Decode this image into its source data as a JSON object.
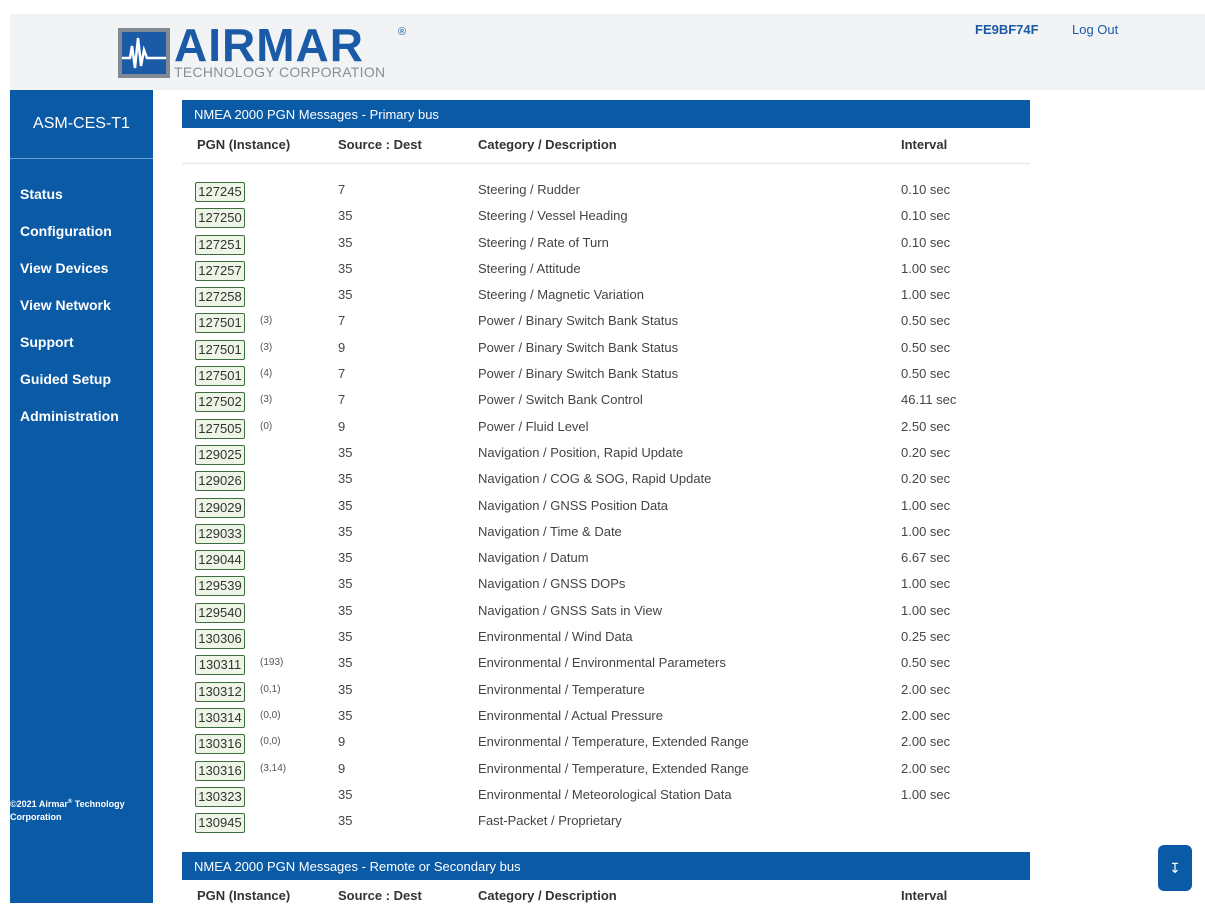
{
  "header": {
    "logo_word": "AIRMAR",
    "logo_reg": "®",
    "logo_sub": "TECHNOLOGY CORPORATION",
    "device_id": "FE9BF74F",
    "logout_label": "Log Out"
  },
  "sidebar": {
    "unit_name": "ASM-CES-T1",
    "items": [
      {
        "label": "Status"
      },
      {
        "label": "Configuration"
      },
      {
        "label": "View Devices"
      },
      {
        "label": "View Network"
      },
      {
        "label": "Support"
      },
      {
        "label": "Guided Setup"
      },
      {
        "label": "Administration"
      }
    ],
    "copyright_line1": "©2021 Airmar",
    "copyright_reg": "®",
    "copyright_line1_rest": " Technology",
    "copyright_line2": "Corporation"
  },
  "primary": {
    "title": "NMEA 2000 PGN Messages - Primary bus",
    "columns": {
      "pgn": "PGN (Instance)",
      "src": "Source : Dest",
      "desc": "Category / Description",
      "interval": "Interval"
    },
    "rows": [
      {
        "pgn": "127245",
        "inst": "",
        "src": "7",
        "desc": "Steering / Rudder",
        "interval": "0.10 sec"
      },
      {
        "pgn": "127250",
        "inst": "",
        "src": "35",
        "desc": "Steering / Vessel Heading",
        "interval": "0.10 sec"
      },
      {
        "pgn": "127251",
        "inst": "",
        "src": "35",
        "desc": "Steering / Rate of Turn",
        "interval": "0.10 sec"
      },
      {
        "pgn": "127257",
        "inst": "",
        "src": "35",
        "desc": "Steering / Attitude",
        "interval": "1.00 sec"
      },
      {
        "pgn": "127258",
        "inst": "",
        "src": "35",
        "desc": "Steering / Magnetic Variation",
        "interval": "1.00 sec"
      },
      {
        "pgn": "127501",
        "inst": "(3)",
        "src": "7",
        "desc": "Power / Binary Switch Bank Status",
        "interval": "0.50 sec"
      },
      {
        "pgn": "127501",
        "inst": "(3)",
        "src": "9",
        "desc": "Power / Binary Switch Bank Status",
        "interval": "0.50 sec"
      },
      {
        "pgn": "127501",
        "inst": "(4)",
        "src": "7",
        "desc": "Power / Binary Switch Bank Status",
        "interval": "0.50 sec"
      },
      {
        "pgn": "127502",
        "inst": "(3)",
        "src": "7",
        "desc": "Power / Switch Bank Control",
        "interval": "46.11 sec"
      },
      {
        "pgn": "127505",
        "inst": "(0)",
        "src": "9",
        "desc": "Power / Fluid Level",
        "interval": "2.50 sec"
      },
      {
        "pgn": "129025",
        "inst": "",
        "src": "35",
        "desc": "Navigation / Position, Rapid Update",
        "interval": "0.20 sec"
      },
      {
        "pgn": "129026",
        "inst": "",
        "src": "35",
        "desc": "Navigation / COG & SOG, Rapid Update",
        "interval": "0.20 sec"
      },
      {
        "pgn": "129029",
        "inst": "",
        "src": "35",
        "desc": "Navigation / GNSS Position Data",
        "interval": "1.00 sec"
      },
      {
        "pgn": "129033",
        "inst": "",
        "src": "35",
        "desc": "Navigation / Time & Date",
        "interval": "1.00 sec"
      },
      {
        "pgn": "129044",
        "inst": "",
        "src": "35",
        "desc": "Navigation / Datum",
        "interval": "6.67 sec"
      },
      {
        "pgn": "129539",
        "inst": "",
        "src": "35",
        "desc": "Navigation / GNSS DOPs",
        "interval": "1.00 sec"
      },
      {
        "pgn": "129540",
        "inst": "",
        "src": "35",
        "desc": "Navigation / GNSS Sats in View",
        "interval": "1.00 sec"
      },
      {
        "pgn": "130306",
        "inst": "",
        "src": "35",
        "desc": "Environmental / Wind Data",
        "interval": "0.25 sec"
      },
      {
        "pgn": "130311",
        "inst": "(193)",
        "src": "35",
        "desc": "Environmental / Environmental Parameters",
        "interval": "0.50 sec"
      },
      {
        "pgn": "130312",
        "inst": "(0,1)",
        "src": "35",
        "desc": "Environmental / Temperature",
        "interval": "2.00 sec"
      },
      {
        "pgn": "130314",
        "inst": "(0,0)",
        "src": "35",
        "desc": "Environmental / Actual Pressure",
        "interval": "2.00 sec"
      },
      {
        "pgn": "130316",
        "inst": "(0,0)",
        "src": "9",
        "desc": "Environmental / Temperature, Extended Range",
        "interval": "2.00 sec"
      },
      {
        "pgn": "130316",
        "inst": "(3,14)",
        "src": "9",
        "desc": "Environmental / Temperature, Extended Range",
        "interval": "2.00 sec"
      },
      {
        "pgn": "130323",
        "inst": "",
        "src": "35",
        "desc": "Environmental / Meteorological Station Data",
        "interval": "1.00 sec"
      },
      {
        "pgn": "130945",
        "inst": "",
        "src": "35",
        "desc": "Fast-Packet / Proprietary",
        "interval": ""
      }
    ]
  },
  "secondary": {
    "title": "NMEA 2000 PGN Messages - Remote or Secondary bus",
    "columns": {
      "pgn": "PGN (Instance)",
      "src": "Source : Dest",
      "desc": "Category / Description",
      "interval": "Interval"
    }
  },
  "scroll_button": {
    "icon": "↧"
  },
  "colors": {
    "brand_blue": "#0b5aa6",
    "pgn_border": "#3d6e3d",
    "pgn_fill": "#eef5e6"
  }
}
